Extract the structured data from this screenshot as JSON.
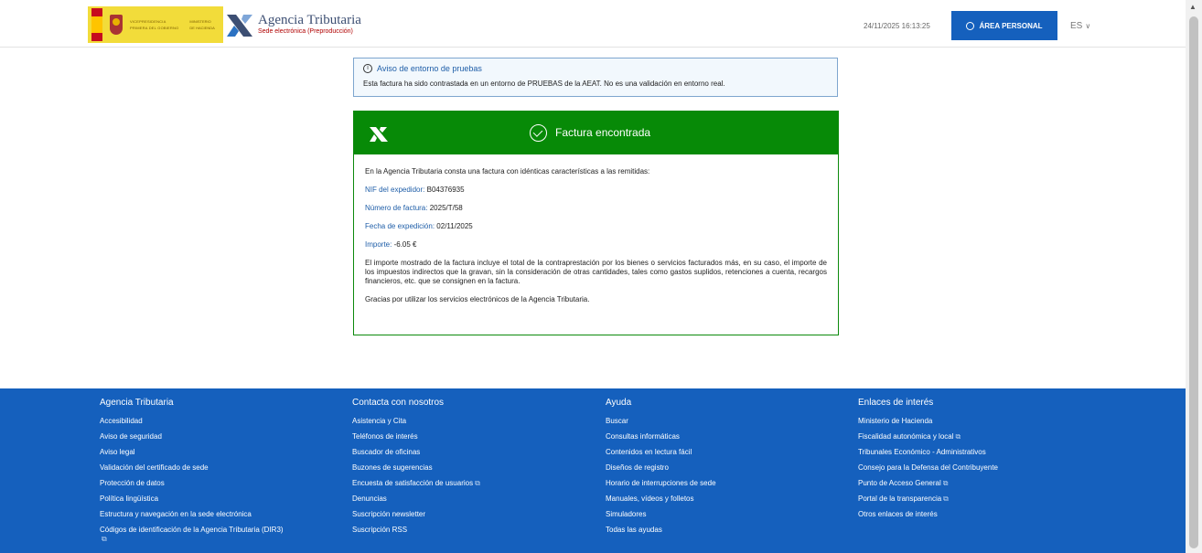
{
  "header": {
    "gov_line1": "VICEPRESIDENCIA",
    "gov_line2": "PRIMERA DEL GOBIERNO",
    "gov_line3": "MINISTERIO",
    "gov_line4": "DE HACIENDA",
    "brand_name": "Agencia Tributaria",
    "brand_sub": "Sede electrónica (Preproducción)",
    "datetime": "24/11/2025 16:13:25",
    "area_button": "ÁREA PERSONAL",
    "lang": "ES"
  },
  "notice": {
    "title": "Aviso de entorno de pruebas",
    "text": "Esta factura ha sido contrastada en un entorno de PRUEBAS de la AEAT. No es una validación en entorno real."
  },
  "card": {
    "title": "Factura encontrada",
    "intro": "En la Agencia Tributaria consta una factura con idénticas características a las remitidas:",
    "fields": [
      {
        "label": "NIF del expedidor:",
        "value": "B04376935"
      },
      {
        "label": "Número de factura:",
        "value": "2025/T/58"
      },
      {
        "label": "Fecha de expedición:",
        "value": "02/11/2025"
      },
      {
        "label": "Importe:",
        "value": "-6.05 €"
      }
    ],
    "disclaimer": "El importe mostrado de la factura incluye el total de la contraprestación por los bienes o servicios facturados más, en su caso, el importe de los impuestos indirectos que la gravan, sin la consideración de otras cantidades, tales como gastos suplidos, retenciones a cuenta, recargos financieros, etc. que se consignen en la factura.",
    "thanks": "Gracias por utilizar los servicios electrónicos de la Agencia Tributaria."
  },
  "footer": {
    "columns": [
      {
        "title": "Agencia Tributaria",
        "links": [
          "Accesibilidad",
          "Aviso de seguridad",
          "Aviso legal",
          "Validación del certificado de sede",
          "Protección de datos",
          "Política lingüística",
          "Estructura y navegación en la sede electrónica",
          "Códigos de identificación de la Agencia Tributaria (DIR3)"
        ]
      },
      {
        "title": "Contacta con nosotros",
        "links": [
          "Asistencia y Cita",
          "Teléfonos de interés",
          "Buscador de oficinas",
          "Buzones de sugerencias",
          "Encuesta de satisfacción de usuarios",
          "Denuncias",
          "Suscripción newsletter",
          "Suscripción RSS"
        ]
      },
      {
        "title": "Ayuda",
        "links": [
          "Buscar",
          "Consultas informáticas",
          "Contenidos en lectura fácil",
          "Diseños de registro",
          "Horario de interrupciones de sede",
          "Manuales, vídeos y folletos",
          "Simuladores",
          "Todas las ayudas"
        ]
      },
      {
        "title": "Enlaces de interés",
        "links": [
          "Ministerio de Hacienda",
          "Fiscalidad autonómica y local",
          "Tribunales Económico - Administrativos",
          "Consejo para la Defensa del Contribuyente",
          "Punto de Acceso General",
          "Portal de la transparencia",
          "Otros enlaces de interés"
        ]
      }
    ]
  },
  "colors": {
    "brand_blue": "#1560bd",
    "success_green": "#078a07",
    "link_blue": "#1f5ea8"
  }
}
